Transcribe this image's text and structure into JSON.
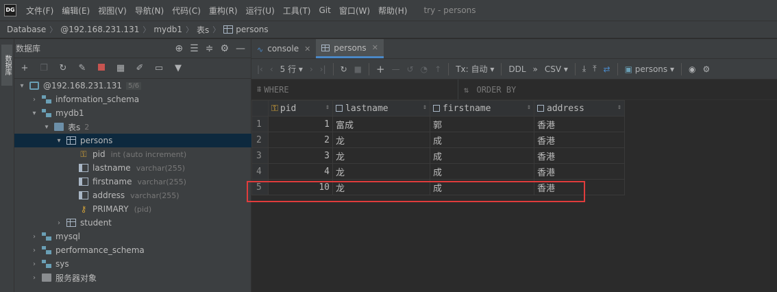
{
  "app": {
    "logo": "DG",
    "window_title": "try - persons"
  },
  "menu": [
    "文件(F)",
    "编辑(E)",
    "视图(V)",
    "导航(N)",
    "代码(C)",
    "重构(R)",
    "运行(U)",
    "工具(T)",
    "Git",
    "窗口(W)",
    "帮助(H)"
  ],
  "breadcrumb": [
    "Database",
    "@192.168.231.131",
    "mydb1",
    "表s",
    "persons"
  ],
  "left_strip_label": "数据库",
  "db_panel": {
    "title": "数据库",
    "tree": {
      "host": {
        "label": "@192.168.231.131",
        "badge": "5/6"
      },
      "information_schema": "information_schema",
      "mydb1": "mydb1",
      "tables_folder": {
        "label": "表s",
        "count": "2"
      },
      "persons": "persons",
      "columns": [
        {
          "name": "pid",
          "type": "int (auto increment)"
        },
        {
          "name": "lastname",
          "type": "varchar(255)"
        },
        {
          "name": "firstname",
          "type": "varchar(255)"
        },
        {
          "name": "address",
          "type": "varchar(255)"
        }
      ],
      "primary": {
        "name": "PRIMARY",
        "meta": "(pid)"
      },
      "student": "student",
      "mysql": "mysql",
      "performance_schema": "performance_schema",
      "sys": "sys",
      "server_objects": "服务器对象"
    }
  },
  "tabs": [
    {
      "label": "console"
    },
    {
      "label": "persons"
    }
  ],
  "grid_toolbar": {
    "rows": "5 行",
    "tx": "Tx: 自动",
    "ddl": "DDL",
    "more": "»",
    "format": "CSV",
    "table_selector": "persons"
  },
  "filter": {
    "where": "WHERE",
    "order_by": "ORDER BY"
  },
  "grid": {
    "columns": [
      "pid",
      "lastname",
      "firstname",
      "address"
    ],
    "rows": [
      {
        "num": "1",
        "pid": "1",
        "lastname": "富成",
        "firstname": "郭",
        "address": "香港"
      },
      {
        "num": "2",
        "pid": "2",
        "lastname": "龙",
        "firstname": "成",
        "address": "香港"
      },
      {
        "num": "3",
        "pid": "3",
        "lastname": "龙",
        "firstname": "成",
        "address": "香港"
      },
      {
        "num": "4",
        "pid": "4",
        "lastname": "龙",
        "firstname": "成",
        "address": "香港"
      },
      {
        "num": "5",
        "pid": "10",
        "lastname": "龙",
        "firstname": "成",
        "address": "香港"
      }
    ]
  },
  "colors": {
    "highlight": "#e03c3c",
    "accent": "#4a88c7",
    "selected_row": "#0d293e"
  }
}
